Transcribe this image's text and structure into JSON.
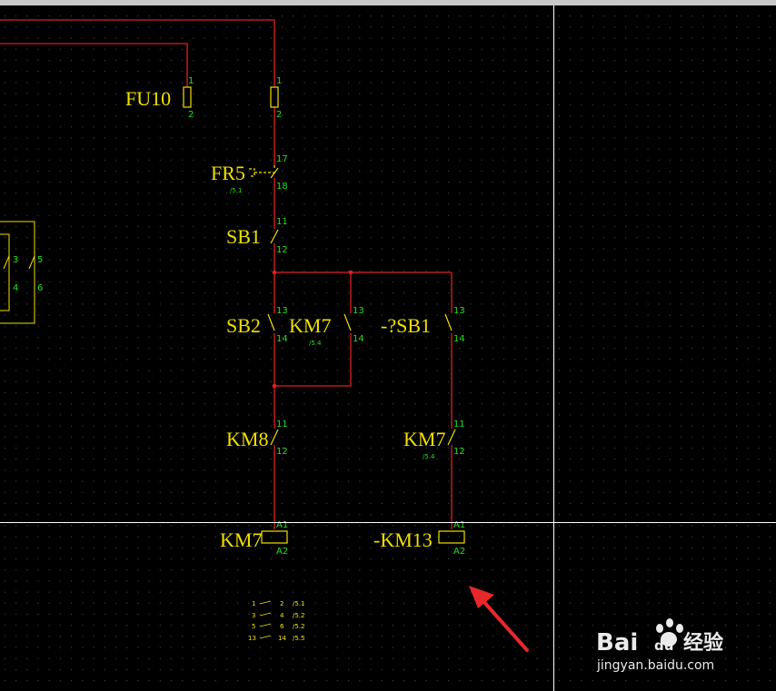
{
  "colors": {
    "background": "#000000",
    "grid_dot": "#5a5a5a",
    "wire": "#e02020",
    "symbol": "#f0e000",
    "pin": "#20e020",
    "crosshair": "#ffffff",
    "arrow": "#e82828"
  },
  "components": {
    "fu10": {
      "label": "FU10",
      "pin_top": "1",
      "pin_bottom": "2"
    },
    "fuse2": {
      "pin_top": "1",
      "pin_bottom": "2"
    },
    "fr5": {
      "label": "FR5",
      "pin_top": "17",
      "pin_bottom": "18",
      "ref": "/5.1"
    },
    "sb1": {
      "label": "SB1",
      "pin_top": "11",
      "pin_bottom": "12"
    },
    "sb2": {
      "label": "SB2",
      "pin_top": "13",
      "pin_bottom": "14"
    },
    "km7_no": {
      "label": "KM7",
      "pin_top": "13",
      "pin_bottom": "14",
      "ref": "/5.4"
    },
    "sb1_no": {
      "label": "-?SB1",
      "pin_top": "13",
      "pin_bottom": "14"
    },
    "km8_nc": {
      "label": "KM8",
      "pin_top": "11",
      "pin_bottom": "12"
    },
    "km7_nc": {
      "label": "KM7",
      "pin_top": "11",
      "pin_bottom": "12",
      "ref": "/5.4"
    },
    "km7_coil": {
      "label": "KM7",
      "pin_top": "A1",
      "pin_bottom": "A2"
    },
    "km13_coil": {
      "label": "-KM13",
      "pin_top": "A1",
      "pin_bottom": "A2"
    },
    "left_switch": {
      "pins": [
        "3",
        "4",
        "5",
        "6"
      ]
    }
  },
  "contact_table": [
    {
      "a": "1",
      "b": "2",
      "ref": "/5.1"
    },
    {
      "a": "3",
      "b": "4",
      "ref": "/5.2"
    },
    {
      "a": "5",
      "b": "6",
      "ref": "/5.2"
    },
    {
      "a": "13",
      "b": "14",
      "ref": "/5.5"
    }
  ],
  "watermark": {
    "brand_a": "Bai",
    "brand_b": "du",
    "brand_c": "经验",
    "url": "jingyan.baidu.com"
  }
}
